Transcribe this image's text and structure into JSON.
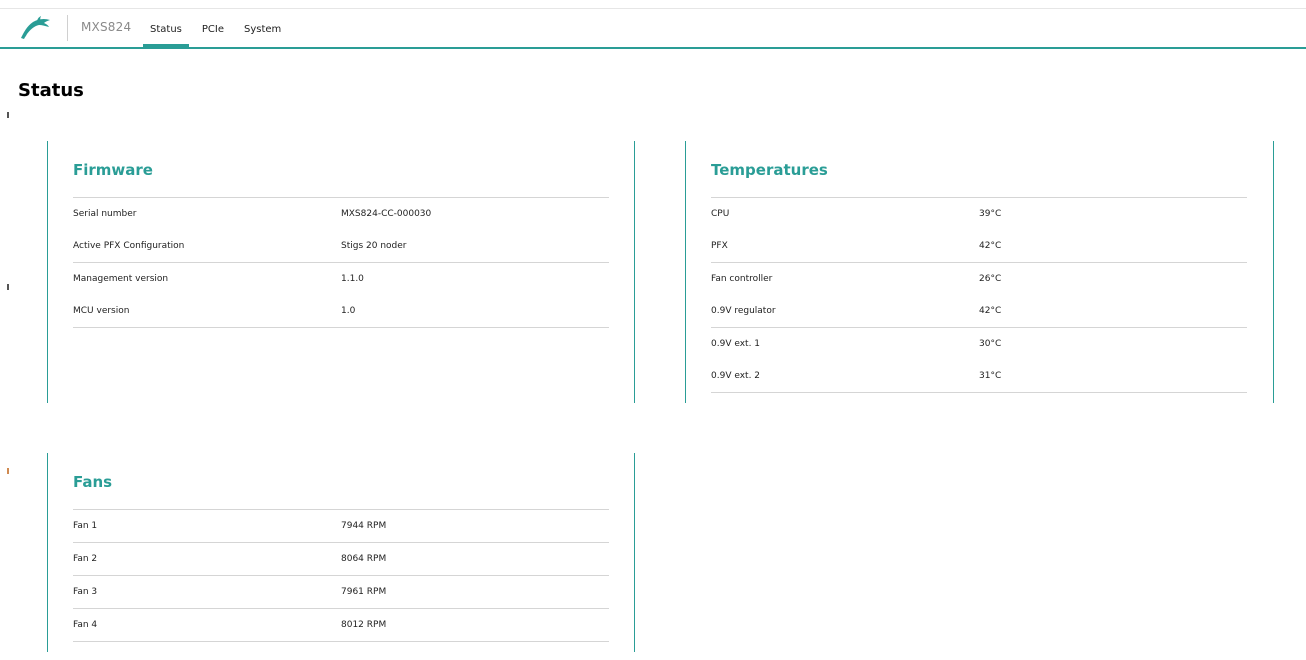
{
  "header": {
    "brand": "MXS824",
    "accent_color": "#2a9d96",
    "logo_icon": "dolphin-icon",
    "tabs": [
      {
        "label": "Status",
        "active": true
      },
      {
        "label": "PCIe",
        "active": false
      },
      {
        "label": "System",
        "active": false
      }
    ]
  },
  "page": {
    "title": "Status"
  },
  "firmware": {
    "title": "Firmware",
    "rows": [
      {
        "label": "Serial number",
        "value": "MXS824-CC-000030"
      },
      {
        "label": "Active PFX Configuration",
        "value": "Stigs 20 noder"
      },
      {
        "label": "Management version",
        "value": "1.1.0"
      },
      {
        "label": "MCU version",
        "value": "1.0"
      }
    ]
  },
  "temperatures": {
    "title": "Temperatures",
    "rows": [
      {
        "label": "CPU",
        "value": "39°C"
      },
      {
        "label": "PFX",
        "value": "42°C"
      },
      {
        "label": "Fan controller",
        "value": "26°C"
      },
      {
        "label": "0.9V regulator",
        "value": "42°C"
      },
      {
        "label": "0.9V ext. 1",
        "value": "30°C"
      },
      {
        "label": "0.9V ext. 2",
        "value": "31°C"
      }
    ]
  },
  "fans": {
    "title": "Fans",
    "rows": [
      {
        "label": "Fan 1",
        "value": "7944 RPM"
      },
      {
        "label": "Fan 2",
        "value": "8064 RPM"
      },
      {
        "label": "Fan 3",
        "value": "7961 RPM"
      },
      {
        "label": "Fan 4",
        "value": "8012 RPM"
      }
    ]
  }
}
